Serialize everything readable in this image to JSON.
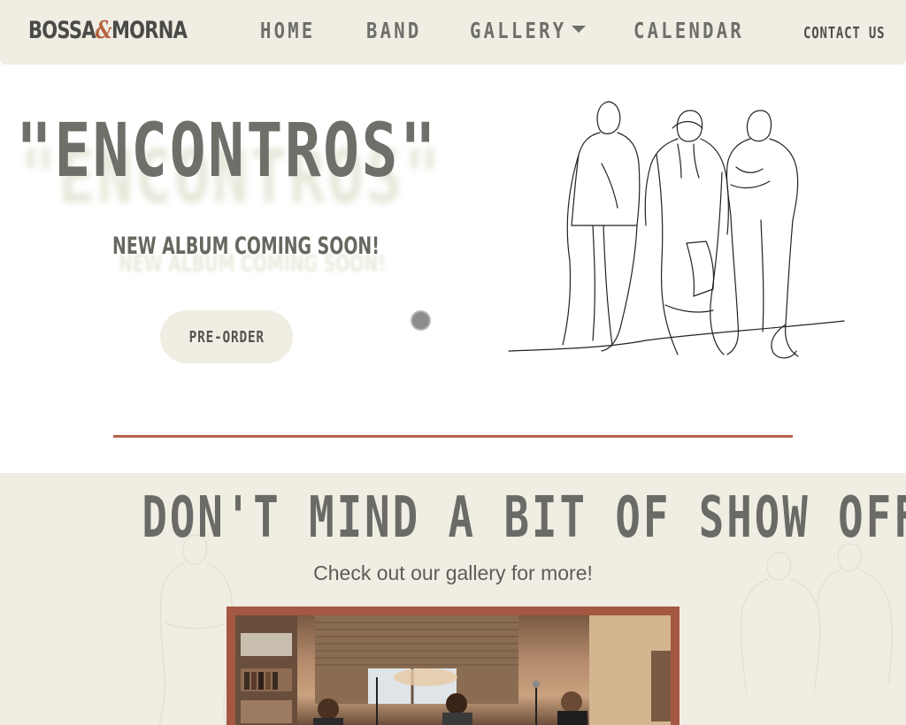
{
  "nav": {
    "brand_left": "BOSSA",
    "brand_amp": "&",
    "brand_right": "MORNA",
    "home": "HOME",
    "band": "BAND",
    "gallery": "GALLERY",
    "calendar": "CALENDAR",
    "contact": "CONTACT US"
  },
  "hero": {
    "title": "\"ENCONTROS\"",
    "subtitle": "NEW ALBUM COMING SOON!",
    "button": "PRE-ORDER",
    "illustration_icon": "band-line-drawing-icon"
  },
  "showoff": {
    "title": "DON'T MIND A BIT OF SHOW OFF!",
    "subtitle": "Check out our gallery for more!"
  },
  "colors": {
    "nav_bg": "#f0ede3",
    "accent": "#b5634a",
    "text": "#6b6b66",
    "button_bg": "#f0ede3"
  }
}
